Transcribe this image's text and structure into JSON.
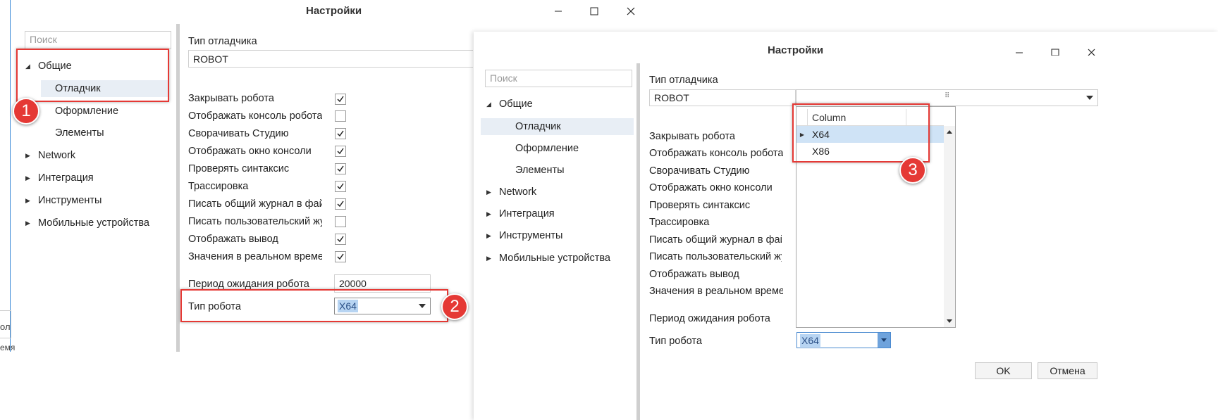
{
  "window1": {
    "title": "Настройки",
    "search_placeholder": "Поиск",
    "tree": [
      {
        "label": "Общие",
        "expanded": true
      },
      {
        "label": "Отладчик",
        "selected": true
      },
      {
        "label": "Оформление"
      },
      {
        "label": "Элементы"
      },
      {
        "label": "Network"
      },
      {
        "label": "Интеграция"
      },
      {
        "label": "Инструменты"
      },
      {
        "label": "Мобильные устройства"
      }
    ],
    "debugger_type_label": "Тип отладчика",
    "debugger_type_value": "ROBOT",
    "options": [
      {
        "label": "Закрывать робота",
        "checked": true
      },
      {
        "label": "Отображать консоль робота",
        "checked": false
      },
      {
        "label": "Сворачивать Студию",
        "checked": true
      },
      {
        "label": "Отображать окно консоли",
        "checked": true
      },
      {
        "label": "Проверять синтаксис",
        "checked": true
      },
      {
        "label": "Трассировка",
        "checked": true
      },
      {
        "label": "Писать общий журнал в файл",
        "checked": true
      },
      {
        "label": "Писать пользовательский жур",
        "checked": false
      },
      {
        "label": "Отображать вывод",
        "checked": true
      },
      {
        "label": "Значения в реальном времени",
        "checked": true
      }
    ],
    "wait_period_label": "Период ожидания робота",
    "wait_period_value": "20000",
    "robot_type_label": "Тип робота",
    "robot_type_value": "X64"
  },
  "window2": {
    "title": "Настройки",
    "search_placeholder": "Поиск",
    "tree": [
      {
        "label": "Общие",
        "expanded": true
      },
      {
        "label": "Отладчик",
        "selected": true
      },
      {
        "label": "Оформление"
      },
      {
        "label": "Элементы"
      },
      {
        "label": "Network"
      },
      {
        "label": "Интеграция"
      },
      {
        "label": "Инструменты"
      },
      {
        "label": "Мобильные устройства"
      }
    ],
    "debugger_type_label": "Тип отладчика",
    "debugger_type_value": "ROBOT",
    "options": [
      "Закрывать робота",
      "Отображать консоль робота",
      "Сворачивать Студию",
      "Отображать окно консоли",
      "Проверять синтаксис",
      "Трассировка",
      "Писать общий журнал в файл",
      "Писать пользовательский жур",
      "Отображать вывод",
      "Значения в реальном времени"
    ],
    "wait_period_label": "Период ожидания робота",
    "robot_type_label": "Тип робота",
    "robot_type_value": "X64",
    "dropdown": {
      "column_header": "Column",
      "rows": [
        "X64",
        "X86"
      ],
      "selected": "X64"
    },
    "ok_label": "OK",
    "cancel_label": "Отмена"
  },
  "badges": [
    "1",
    "2",
    "3"
  ],
  "background_fragments": [
    "ол",
    "емя"
  ],
  "colors": {
    "annotation_red": "#e53935",
    "selection_blue": "#b7d4f2",
    "tree_selection": "#e8eef5"
  }
}
